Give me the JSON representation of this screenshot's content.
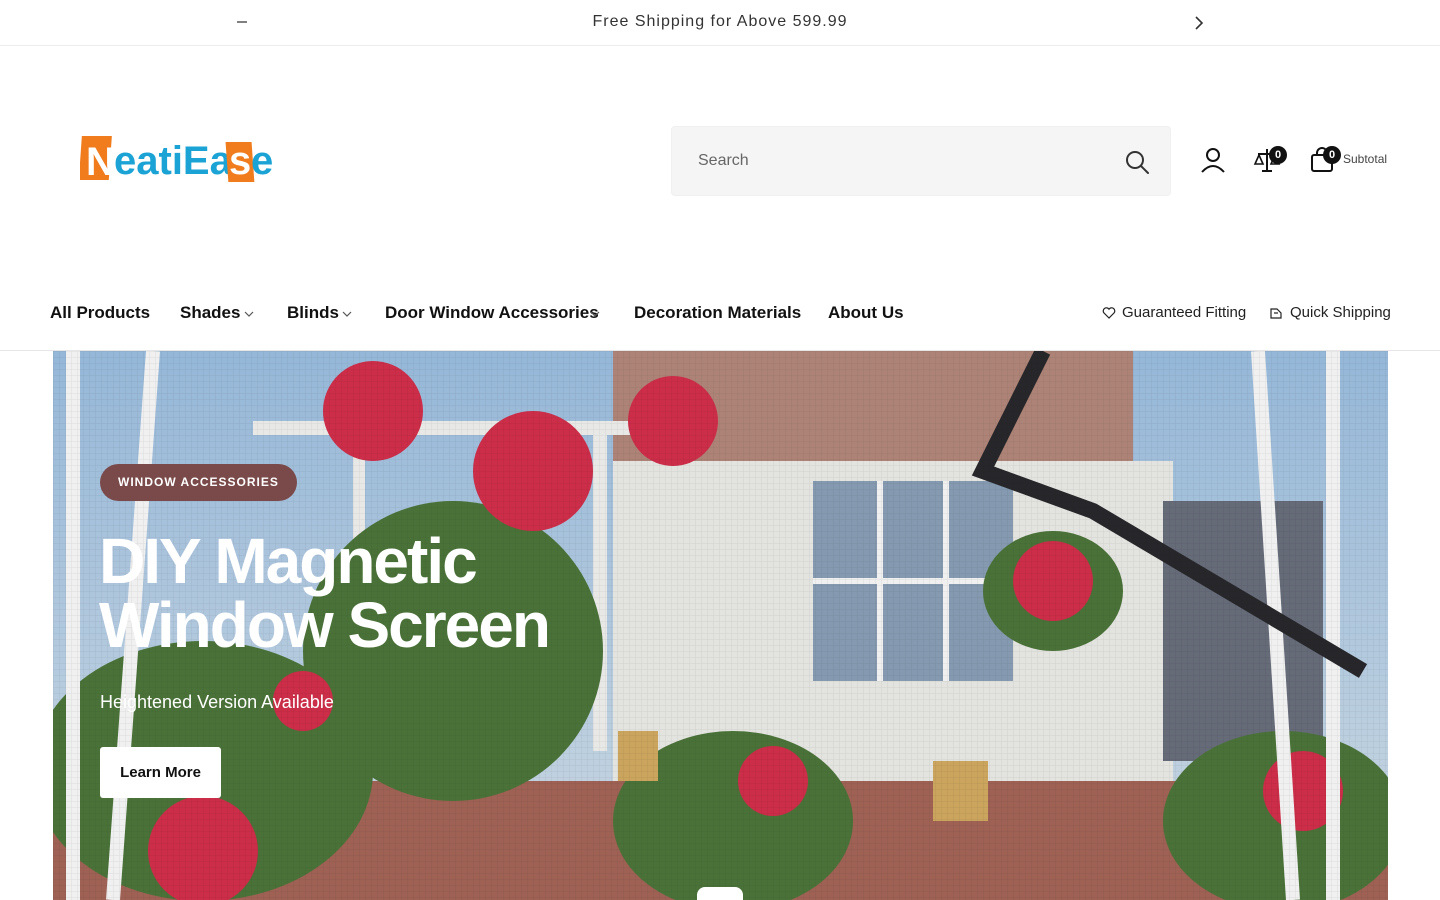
{
  "announcement": {
    "text": "Free Shipping for Above 599.99",
    "prev_icon": "minus-icon",
    "next_icon": "chevron-right-icon"
  },
  "header": {
    "logo_text": "NeatiEase",
    "search": {
      "placeholder": "Search",
      "value": ""
    },
    "account_icon": "user-icon",
    "compare": {
      "icon": "scale-icon",
      "count": "0"
    },
    "cart": {
      "icon": "shopping-bag-icon",
      "count": "0",
      "subtotal_label": "Subtotal"
    }
  },
  "nav": {
    "items": [
      {
        "label": "All Products",
        "has_dropdown": false
      },
      {
        "label": "Shades",
        "has_dropdown": true
      },
      {
        "label": "Blinds",
        "has_dropdown": true
      },
      {
        "label": "Door Window Accessories",
        "has_dropdown": true
      },
      {
        "label": "Decoration Materials",
        "has_dropdown": false
      },
      {
        "label": "About Us",
        "has_dropdown": false
      }
    ],
    "features": [
      {
        "label": "Guaranteed Fitting",
        "icon": "heart-icon"
      },
      {
        "label": "Quick Shipping",
        "icon": "package-icon"
      }
    ]
  },
  "hero": {
    "tag": "WINDOW ACCESSORIES",
    "title": "DIY Magnetic Window Screen",
    "subtitle": "Heightened Version Available",
    "button_label": "Learn More"
  },
  "colors": {
    "logo_orange": "#f07c1e",
    "logo_blue": "#1aa3d4",
    "tag_bg": "#7a4a4a"
  }
}
